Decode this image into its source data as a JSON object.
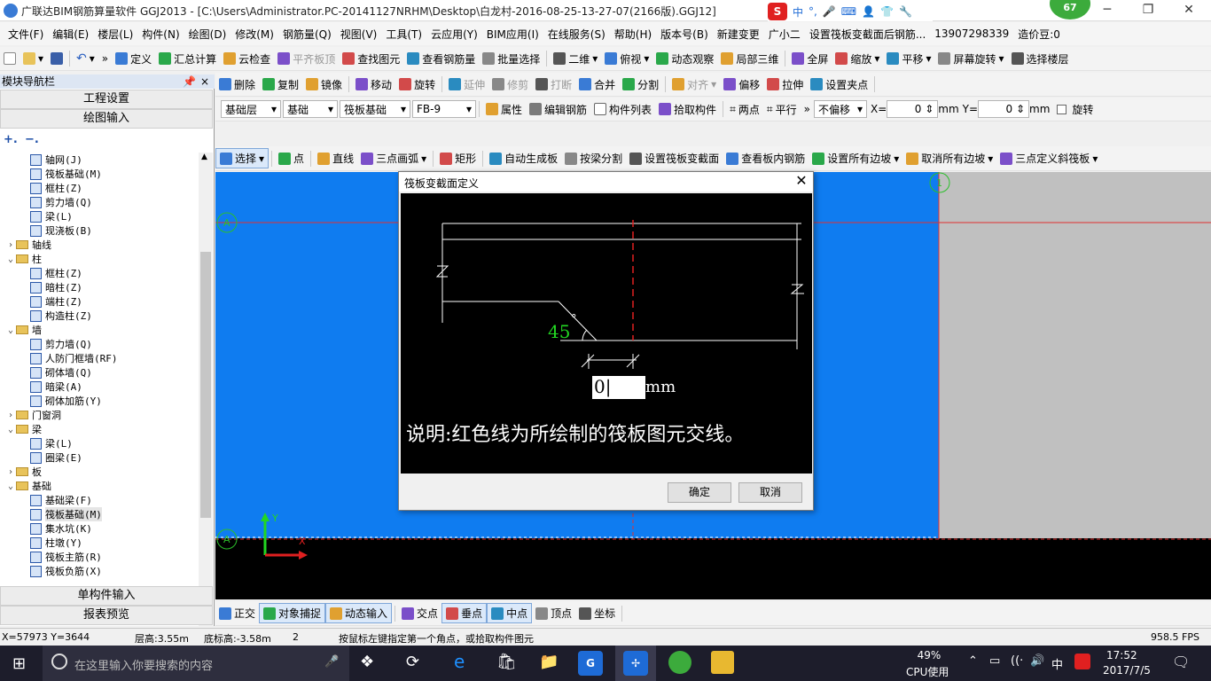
{
  "titlebar": {
    "title": "广联达BIM钢筋算量软件 GGJ2013 - [C:\\Users\\Administrator.PC-20141127NRHM\\Desktop\\白龙村-2016-08-25-13-27-07(2166版).GGJ12]",
    "ime_brand": "S",
    "ime_lang": "中",
    "ime_extra": "°,",
    "score": "67"
  },
  "menu": [
    "文件(F)",
    "编辑(E)",
    "楼层(L)",
    "构件(N)",
    "绘图(D)",
    "修改(M)",
    "钢筋量(Q)",
    "视图(V)",
    "工具(T)",
    "云应用(Y)",
    "BIM应用(I)",
    "在线服务(S)",
    "帮助(H)",
    "版本号(B)",
    "新建变更",
    "广小二",
    "设置筏板变截面后钢筋...",
    "13907298339",
    "造价豆:0"
  ],
  "toolbar1": [
    "定义",
    "汇总计算",
    "云检查",
    "平齐板顶",
    "查找图元",
    "查看钢筋量",
    "批量选择",
    "二维",
    "俯视",
    "动态观察",
    "局部三维",
    "全屏",
    "缩放",
    "平移",
    "屏幕旋转",
    "选择楼层"
  ],
  "toolbar2": [
    "删除",
    "复制",
    "镜像",
    "移动",
    "旋转",
    "延伸",
    "修剪",
    "打断",
    "合并",
    "分割",
    "对齐",
    "偏移",
    "拉伸",
    "设置夹点"
  ],
  "toolbar3": {
    "floor": "基础层",
    "category": "基础",
    "type": "筏板基础",
    "item": "FB-9",
    "attr": "属性",
    "edit_rebar": "编辑钢筋",
    "list": "构件列表",
    "pick": "拾取构件",
    "two_point": "两点",
    "parallel": "平行",
    "offset": "不偏移",
    "x_label": "X=",
    "x_val": "0",
    "x_unit": "mm",
    "y_label": "Y=",
    "y_val": "0",
    "y_unit": "mm",
    "rotate": "旋转"
  },
  "toolbar4": [
    "选择",
    "点",
    "直线",
    "三点画弧",
    "矩形",
    "自动生成板",
    "按梁分割",
    "设置筏板变截面",
    "查看板内钢筋",
    "设置所有边坡",
    "取消所有边坡",
    "三点定义斜筏板"
  ],
  "left_panel": {
    "header": "模块导航栏",
    "pin": "ᵖ",
    "close": "×",
    "btn_settings": "工程设置",
    "btn_draw": "绘图输入",
    "btn_single": "单构件输入",
    "btn_report": "报表预览"
  },
  "tree": [
    {
      "level": 2,
      "label": "轴网(J)"
    },
    {
      "level": 2,
      "label": "筏板基础(M)"
    },
    {
      "level": 2,
      "label": "框柱(Z)"
    },
    {
      "level": 2,
      "label": "剪力墙(Q)"
    },
    {
      "level": 2,
      "label": "梁(L)"
    },
    {
      "level": 2,
      "label": "现浇板(B)"
    },
    {
      "level": 1,
      "label": "轴线",
      "toggle": "›"
    },
    {
      "level": 1,
      "label": "柱",
      "toggle": "⌄"
    },
    {
      "level": 2,
      "label": "框柱(Z)"
    },
    {
      "level": 2,
      "label": "暗柱(Z)"
    },
    {
      "level": 2,
      "label": "端柱(Z)"
    },
    {
      "level": 2,
      "label": "构造柱(Z)"
    },
    {
      "level": 1,
      "label": "墙",
      "toggle": "⌄"
    },
    {
      "level": 2,
      "label": "剪力墙(Q)"
    },
    {
      "level": 2,
      "label": "人防门框墙(RF)"
    },
    {
      "level": 2,
      "label": "砌体墙(Q)"
    },
    {
      "level": 2,
      "label": "暗梁(A)"
    },
    {
      "level": 2,
      "label": "砌体加筋(Y)"
    },
    {
      "level": 1,
      "label": "门窗洞",
      "toggle": "›"
    },
    {
      "level": 1,
      "label": "梁",
      "toggle": "⌄"
    },
    {
      "level": 2,
      "label": "梁(L)"
    },
    {
      "level": 2,
      "label": "圈梁(E)"
    },
    {
      "level": 1,
      "label": "板",
      "toggle": "›"
    },
    {
      "level": 1,
      "label": "基础",
      "toggle": "⌄"
    },
    {
      "level": 2,
      "label": "基础梁(F)"
    },
    {
      "level": 2,
      "label": "筏板基础(M)",
      "selected": true
    },
    {
      "level": 2,
      "label": "集水坑(K)"
    },
    {
      "level": 2,
      "label": "柱墩(Y)"
    },
    {
      "level": 2,
      "label": "筏板主筋(R)"
    },
    {
      "level": 2,
      "label": "筏板负筋(X)"
    }
  ],
  "canvas": {
    "axis_a_top": "A",
    "axis_a_bottom": "A",
    "axis_right": "1",
    "y_axis": "Y",
    "x_axis": "X"
  },
  "dialog": {
    "title": "筏板变截面定义",
    "angle": "45",
    "degree": "°",
    "input_value": "0",
    "unit": "mm",
    "note": "说明:红色线为所绘制的筏板图元交线。",
    "ok": "确定",
    "cancel": "取消"
  },
  "snapbar": [
    "正交",
    "对象捕捉",
    "动态输入",
    "交点",
    "垂点",
    "中点",
    "顶点",
    "坐标"
  ],
  "status": {
    "coords": "X=57973 Y=3644",
    "floor_h": "层高:3.55m",
    "base_h": "底标高:-3.58m",
    "num": "2",
    "hint": "按鼠标左键指定第一个角点，或拾取构件图元",
    "fps": "958.5 FPS"
  },
  "taskbar": {
    "search": "在这里输入你要搜索的内容",
    "cpu_pct": "49%",
    "cpu_label": "CPU使用",
    "ime": "中",
    "time": "17:52",
    "date": "2017/7/5"
  }
}
